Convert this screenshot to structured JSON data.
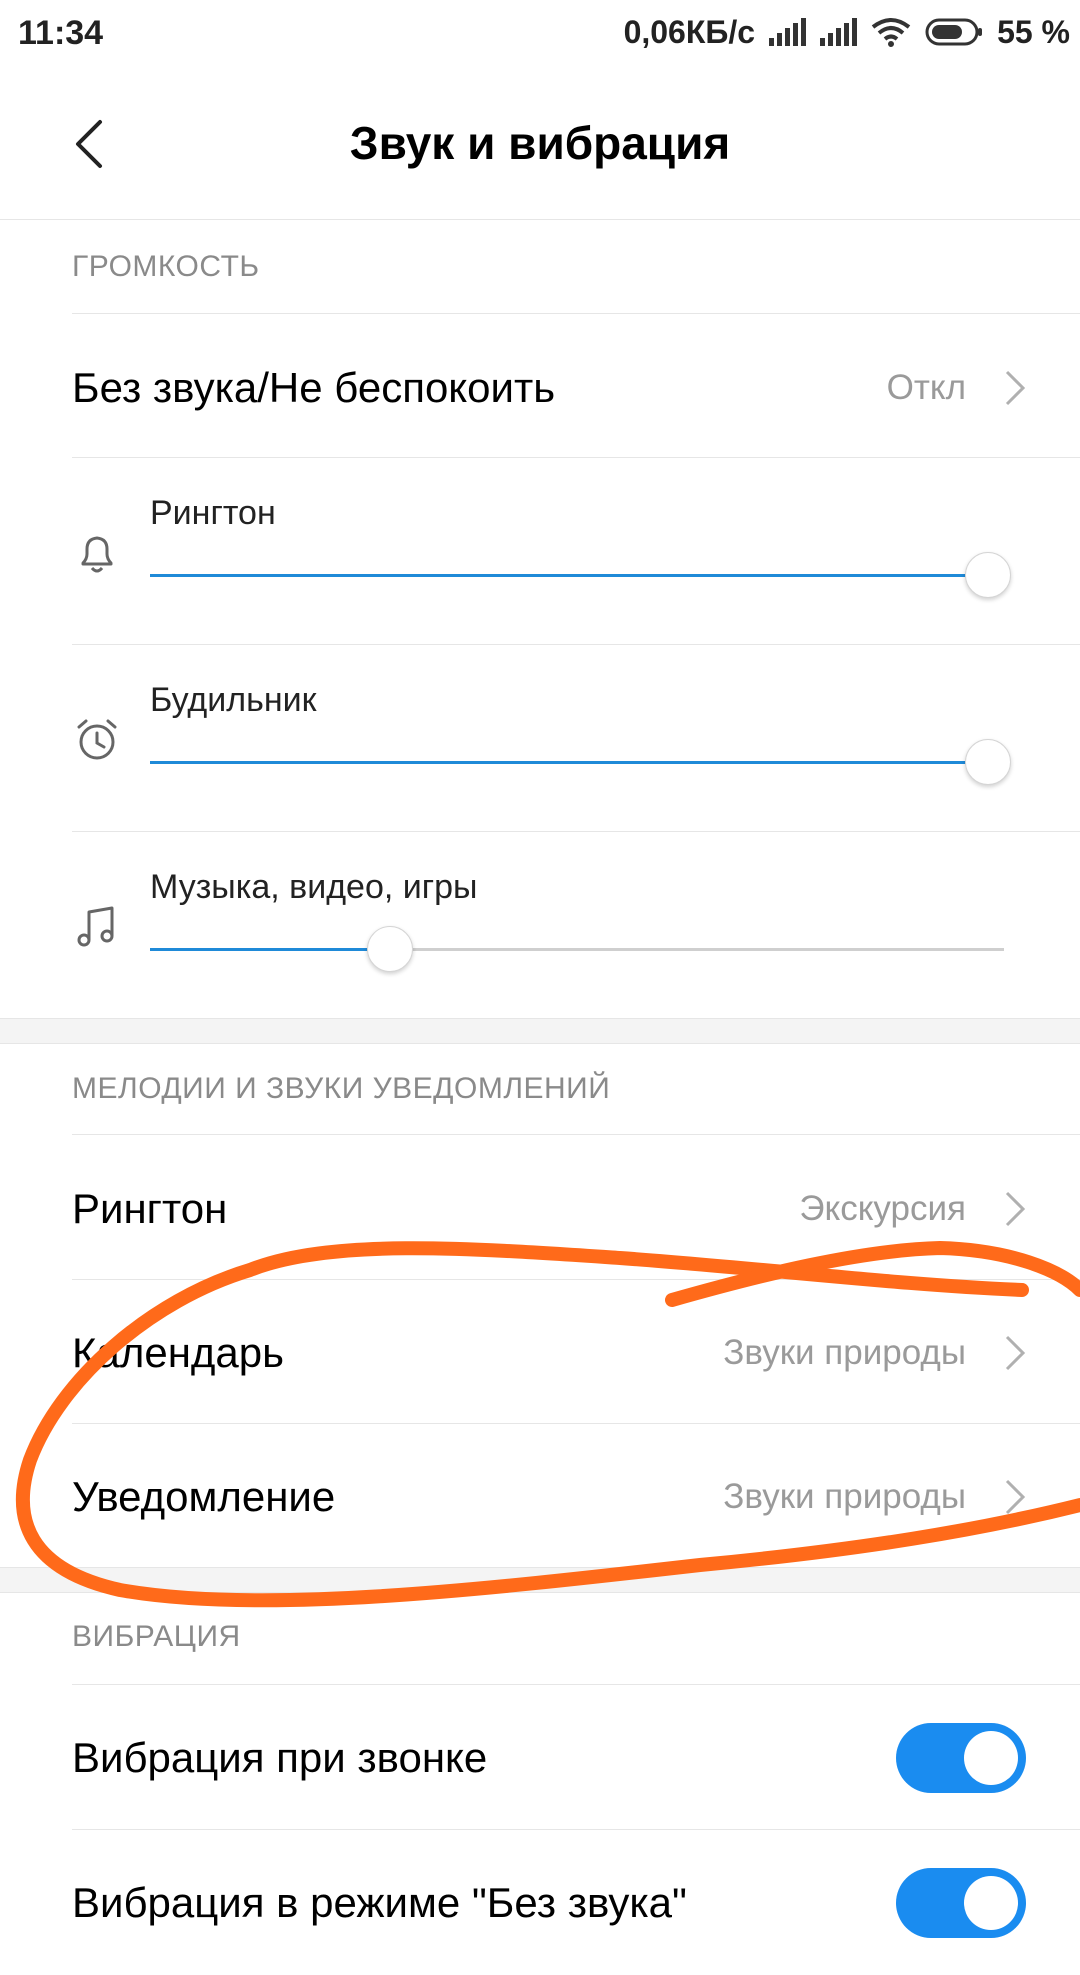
{
  "status_bar": {
    "time": "11:34",
    "network_speed": "0,06КБ/с",
    "battery_percent": "55 %",
    "icons": [
      "signal-icon",
      "signal-icon",
      "wifi-icon",
      "battery-icon"
    ]
  },
  "header": {
    "title": "Звук и вибрация",
    "back_icon": "back-arrow-icon"
  },
  "volume": {
    "section_title": "ГРОМКОСТЬ",
    "silent_mode": {
      "label": "Без звука/Не беспокоить",
      "value": "Откл"
    },
    "sliders": [
      {
        "label": "Рингтон",
        "icon": "bell-icon",
        "level": 0.98
      },
      {
        "label": "Будильник",
        "icon": "alarm-clock-icon",
        "level": 0.98
      },
      {
        "label": "Музыка, видео, игры",
        "icon": "music-note-icon",
        "level": 0.28
      }
    ]
  },
  "sounds": {
    "section_title": "МЕЛОДИИ И ЗВУКИ УВЕДОМЛЕНИЙ",
    "items": [
      {
        "label": "Рингтон",
        "value": "Экскурсия"
      },
      {
        "label": "Календарь",
        "value": "Звуки природы"
      },
      {
        "label": "Уведомление",
        "value": "Звуки природы"
      }
    ]
  },
  "vibration": {
    "section_title": "ВИБРАЦИЯ",
    "items": [
      {
        "label": "Вибрация при звонке",
        "on": true
      },
      {
        "label": "Вибрация в режиме \"Без звука\"",
        "on": true
      }
    ]
  },
  "colors": {
    "accent": "#1f8ad8",
    "toggle_on": "#1a8cf0",
    "annotation_stroke": "#ff6a1a"
  }
}
